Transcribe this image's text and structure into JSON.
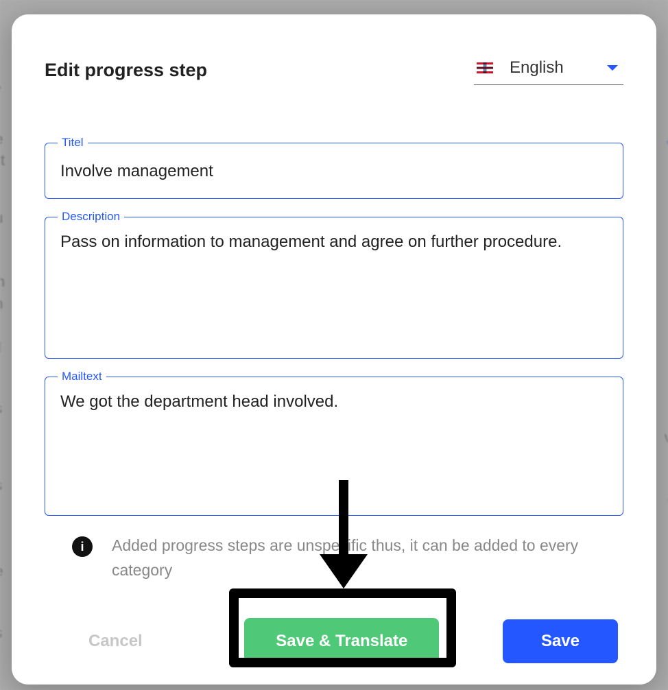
{
  "modal": {
    "title": "Edit progress step",
    "language": {
      "selected": "English"
    },
    "fields": {
      "title": {
        "label": "Titel",
        "value": "Involve management"
      },
      "description": {
        "label": "Description",
        "value": "Pass on information to management and agree on further procedure."
      },
      "mailtext": {
        "label": "Mailtext",
        "value": "We got the department head involved."
      }
    },
    "info": "Added progress steps are unspecific thus, it can be added to every category",
    "buttons": {
      "cancel": "Cancel",
      "save_translate": "Save & Translate",
      "save": "Save"
    }
  }
}
